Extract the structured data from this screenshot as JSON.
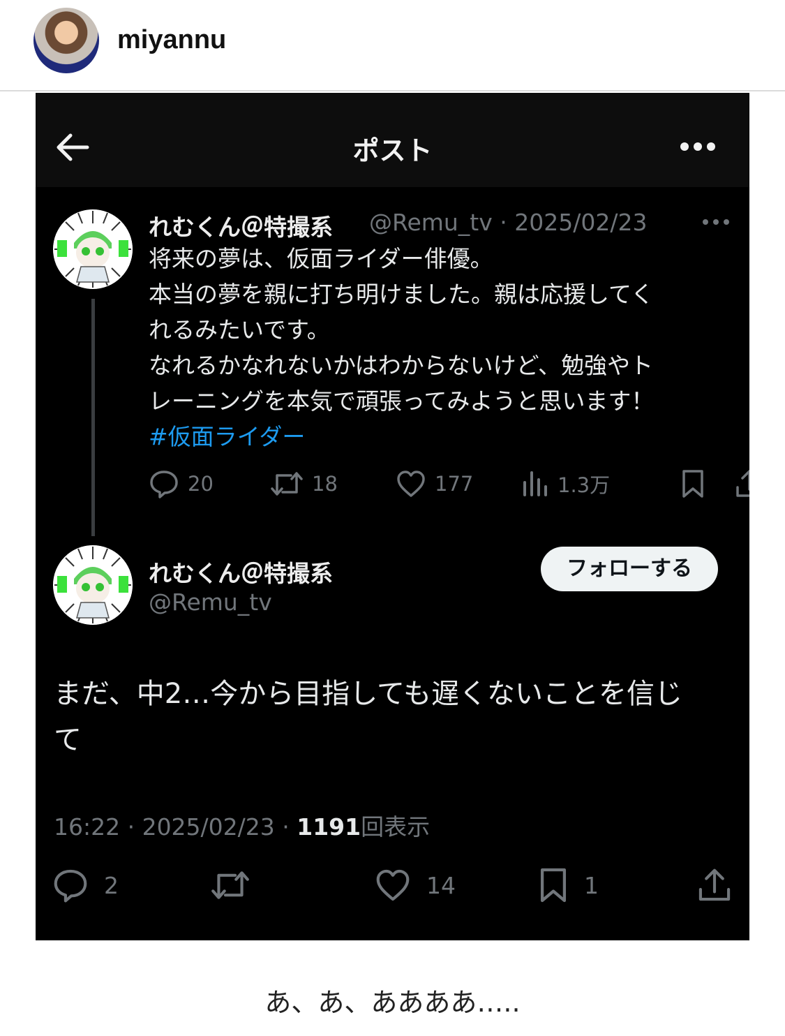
{
  "ig": {
    "username": "miyannu"
  },
  "topbar": {
    "title": "ポスト",
    "back_icon": "arrow-left-icon",
    "more_icon": "more-horizontal-icon"
  },
  "reply_to": {
    "display_name": "れむくん＠特撮系",
    "handle_date": "@Remu_tv · 2025/02/23",
    "lines": [
      "将来の夢は、仮面ライダー俳優。",
      "本当の夢を親に打ち明けました。親は応援してく",
      "れるみたいです。",
      "なれるかなれないかはわからないけど、勉強やト",
      "レーニングを本気で頑張ってみようと思います！"
    ],
    "hashtag": "#仮面ライダー",
    "actions": {
      "replies": "20",
      "reposts": "18",
      "likes": "177",
      "views": "1.3万"
    }
  },
  "post": {
    "display_name": "れむくん＠特撮系",
    "handle": "@Remu_tv",
    "follow_label": "フォローする",
    "lines": [
      "まだ、中2…今から目指しても遅くないことを信じ",
      "て"
    ],
    "time_date": "16:22 · 2025/02/23 · ",
    "view_count": "1191",
    "view_label": "回表示",
    "actions": {
      "replies": "2",
      "likes": "14",
      "bookmarks": "1"
    }
  },
  "caption": "あ、あ、ああああ…..",
  "colors": {
    "background": "#000000",
    "text": "#e7e9ea",
    "muted": "#71767b",
    "link": "#1d9bf0",
    "accent_green": "#3ce13c"
  }
}
